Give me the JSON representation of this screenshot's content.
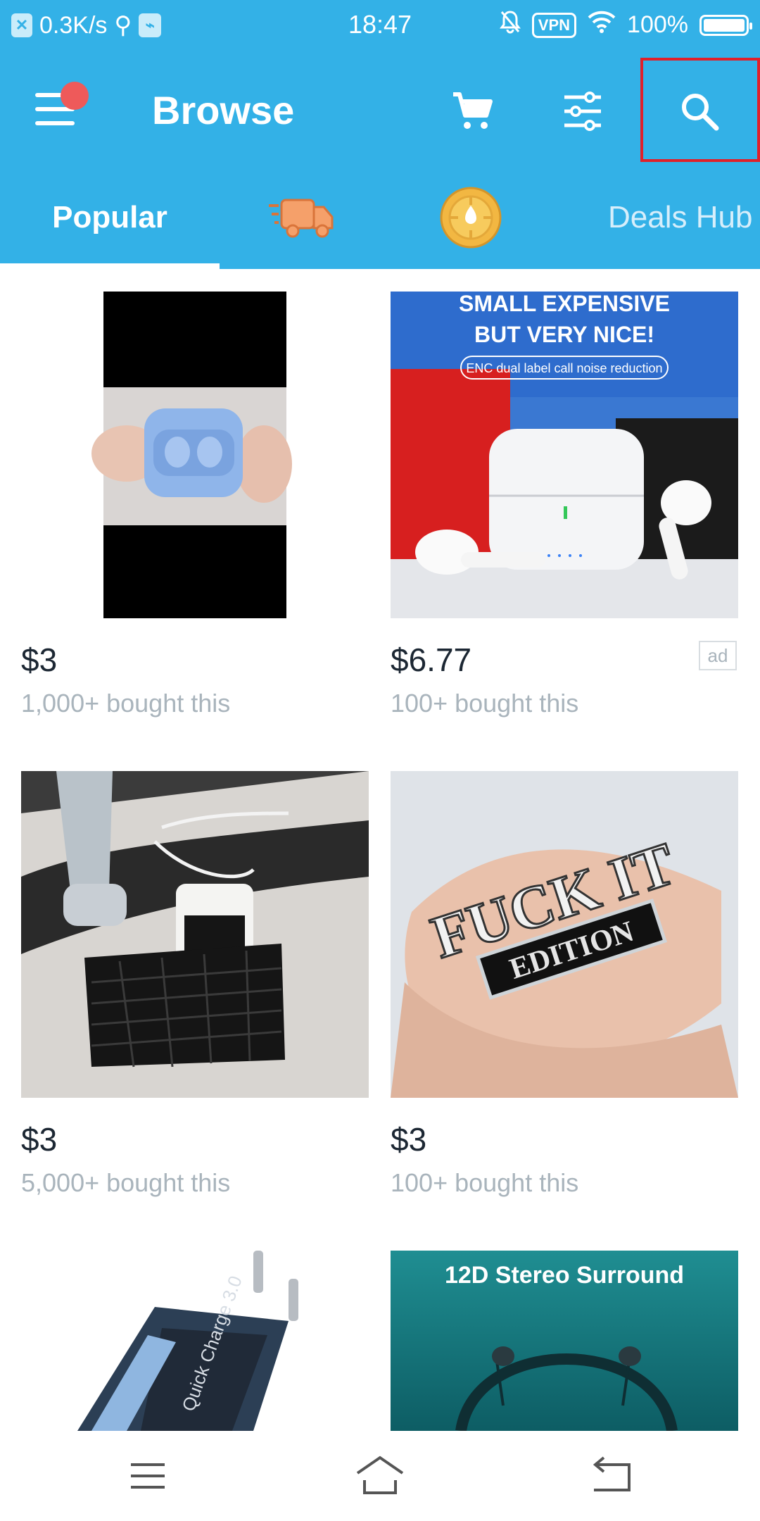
{
  "status_bar": {
    "speed": "0.3K/s",
    "time": "18:47",
    "vpn": "VPN",
    "battery": "100%",
    "battery_level": 1.0
  },
  "header": {
    "title": "Browse",
    "menu_icon": "menu-icon",
    "cart_icon": "cart-icon",
    "filter_icon": "filter-icon",
    "search_icon": "search-icon"
  },
  "tabs": [
    {
      "label": "Popular",
      "active": true
    },
    {
      "label": "",
      "icon": "fast-shipping-icon"
    },
    {
      "label": "",
      "icon": "coin-icon"
    },
    {
      "label": "Deals Hub"
    }
  ],
  "products": [
    {
      "price": "$3",
      "bought": "1,000+ bought this",
      "ad": ""
    },
    {
      "price": "$6.77",
      "bought": "100+ bought this",
      "ad": "ad",
      "banner_line1": "SMALL EXPENSIVE",
      "banner_line2": "BUT VERY NICE!",
      "banner_sub": "ENC dual label call noise reduction"
    },
    {
      "price": "$3",
      "bought": "5,000+ bought this",
      "ad": ""
    },
    {
      "price": "$3",
      "bought": "100+ bought this",
      "ad": "",
      "emblem_top": "FUCK IT",
      "emblem_bottom": "EDITION"
    },
    {
      "price": "",
      "bought": "",
      "ad": "",
      "label": "Quick Charge 3.0"
    },
    {
      "price": "",
      "bought": "",
      "ad": "",
      "banner": "12D Stereo Surround"
    }
  ],
  "colors": {
    "brand_blue": "#33b1e7",
    "text_dark": "#1c2733",
    "text_muted": "#a9b4bc",
    "notification_red": "#ee5a5a",
    "highlight_red": "#e0202a"
  },
  "navigation": {
    "menu": "nav-menu-icon",
    "home": "home-icon",
    "back": "back-icon"
  }
}
